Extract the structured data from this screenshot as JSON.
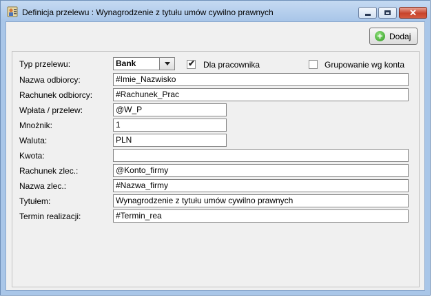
{
  "window": {
    "title": "Definicja przelewu : Wynagrodzenie z tytułu umów cywilno prawnych",
    "minimize_icon": "minimize-icon",
    "maximize_icon": "maximize-icon",
    "close_icon": "close-icon"
  },
  "toolbar": {
    "add_label": "Dodaj",
    "add_icon": "plus-circle-icon",
    "accent": "#2f9a22"
  },
  "form": {
    "typ": {
      "label": "Typ przelewu:",
      "value": "Bank"
    },
    "dla_pracownika": {
      "label": "Dla pracownika",
      "checked": true
    },
    "grupowanie": {
      "label": "Grupowanie wg konta",
      "checked": false
    },
    "nazwa_odbiorcy": {
      "label": "Nazwa odbiorcy:",
      "value": "#Imie_Nazwisko"
    },
    "rachunek_odbiorcy": {
      "label": "Rachunek odbiorcy:",
      "value": "#Rachunek_Prac"
    },
    "wplata": {
      "label": "Wpłata / przelew:",
      "value": "@W_P"
    },
    "mnoznik": {
      "label": "Mnożnik:",
      "value": "1"
    },
    "waluta": {
      "label": "Waluta:",
      "value": "PLN"
    },
    "kwota": {
      "label": "Kwota:",
      "value": ""
    },
    "rachunek_zlec": {
      "label": "Rachunek zlec.:",
      "value": "@Konto_firmy"
    },
    "nazwa_zlec": {
      "label": "Nazwa zlec.:",
      "value": "#Nazwa_firmy"
    },
    "tytulem": {
      "label": "Tytułem:",
      "value": "Wynagrodzenie z tytułu umów cywilno prawnych"
    },
    "termin": {
      "label": "Termin realizacji:",
      "value": "#Termin_rea"
    }
  }
}
